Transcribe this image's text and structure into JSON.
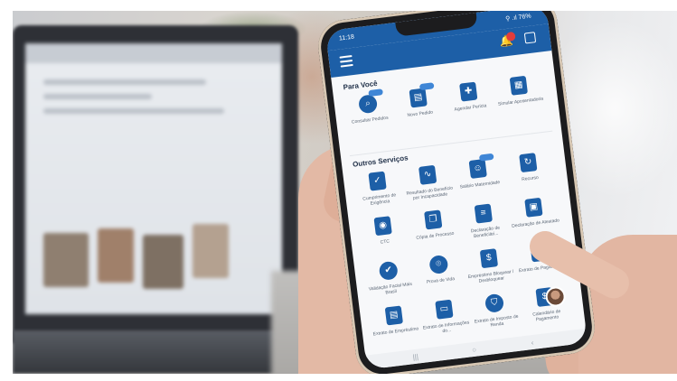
{
  "status_bar": {
    "time": "11:18",
    "right": "⚲ .ıl 76%"
  },
  "sections": {
    "para_voce": "Para Você",
    "outros": "Outros Serviços"
  },
  "para_voce_tiles": [
    {
      "label": "Consultar Pedidos",
      "icon": "search-icon",
      "badge": true
    },
    {
      "label": "Novo Pedido",
      "icon": "document-icon",
      "badge": true
    },
    {
      "label": "Agendar Perícia",
      "icon": "medical-bag-icon",
      "badge": false
    },
    {
      "label": "Simular Aposentadoria",
      "icon": "calculator-document-icon",
      "badge": false
    }
  ],
  "outros_tiles": [
    {
      "label": "Cumprimento de Exigência",
      "icon": "calendar-check-icon",
      "badge": false
    },
    {
      "label": "Resultado do Benefício por Incapacidade",
      "icon": "health-document-icon",
      "badge": false
    },
    {
      "label": "Salário Maternidade",
      "icon": "baby-icon",
      "badge": true
    },
    {
      "label": "Recurso",
      "icon": "refresh-document-icon",
      "badge": false
    },
    {
      "label": "CTC",
      "icon": "certificate-icon",
      "badge": false
    },
    {
      "label": "Cópia de Processo",
      "icon": "copy-icon",
      "badge": false
    },
    {
      "label": "Declaração de Beneficiári...",
      "icon": "list-document-icon",
      "badge": false
    },
    {
      "label": "Declaração de Atestado",
      "icon": "person-document-icon",
      "badge": false
    },
    {
      "label": "Validação Facial Mais Brasil",
      "icon": "user-check-icon",
      "badge": false
    },
    {
      "label": "Prova de Vida",
      "icon": "face-scan-icon",
      "badge": false
    },
    {
      "label": "Empréstimo Bloquear / Desbloquear",
      "icon": "hand-money-icon",
      "badge": false
    },
    {
      "label": "Extrato de Pagamento",
      "icon": "money-document-icon",
      "badge": false
    },
    {
      "label": "Extrato de Empréstimo",
      "icon": "loan-document-icon",
      "badge": false
    },
    {
      "label": "Extrato de Informações do...",
      "icon": "folder-icon",
      "badge": false
    },
    {
      "label": "Extrato de Imposto de Renda",
      "icon": "shield-icon",
      "badge": false
    },
    {
      "label": "Calendário de Pagamento",
      "icon": "calendar-money-icon",
      "badge": false
    }
  ],
  "nav": {
    "recent": "|||",
    "home": "○",
    "back": "‹"
  },
  "colors": {
    "primary": "#1d5fa7",
    "badge": "#e23c3c"
  }
}
